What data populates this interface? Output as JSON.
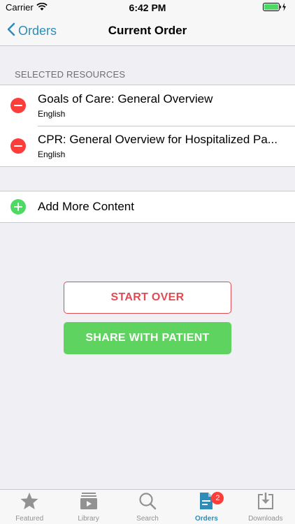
{
  "status_bar": {
    "carrier": "Carrier",
    "time": "6:42 PM"
  },
  "nav": {
    "back_label": "Orders",
    "title": "Current Order"
  },
  "section": {
    "header": "SELECTED RESOURCES"
  },
  "resources": [
    {
      "title": "Goals of Care: General Overview",
      "language": "English"
    },
    {
      "title": "CPR: General Overview for Hospitalized Pa...",
      "language": "English"
    }
  ],
  "add_more": {
    "label": "Add More Content"
  },
  "buttons": {
    "start_over": "START OVER",
    "share": "SHARE WITH PATIENT"
  },
  "tab_bar": {
    "tabs": [
      {
        "label": "Featured",
        "icon": "star-icon"
      },
      {
        "label": "Library",
        "icon": "library-icon"
      },
      {
        "label": "Search",
        "icon": "search-icon"
      },
      {
        "label": "Orders",
        "icon": "orders-icon",
        "badge": "2",
        "active": true
      },
      {
        "label": "Downloads",
        "icon": "download-icon"
      }
    ]
  },
  "colors": {
    "accent": "#2d8cb9",
    "destructive": "#e04b53",
    "success": "#5fd35f",
    "remove": "#fc3d39",
    "add": "#4cd964"
  }
}
